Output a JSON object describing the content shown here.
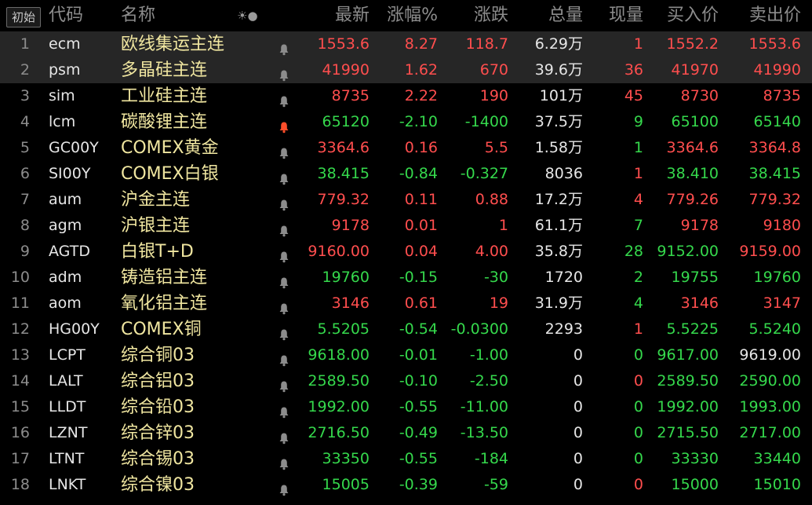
{
  "header": {
    "init_label": "初始",
    "col_code": "代码",
    "col_name": "名称",
    "sort_icon_glyph": "☀●",
    "col_last": "最新",
    "col_pct": "涨幅%",
    "col_change": "涨跌",
    "col_volume": "总量",
    "col_current": "现量",
    "col_bid": "买入价",
    "col_ask": "卖出价"
  },
  "colors": {
    "up": "#ff4e4e",
    "down": "#35d84c",
    "neutral": "#e6e6e6",
    "name": "#f0e6a0",
    "bell_default": "#8c8c8c",
    "bell_active": "#ff4e2a",
    "highlight_row": "#262626"
  },
  "rows": [
    {
      "no": "1",
      "code": "ecm",
      "name": "欧线集运主连",
      "bell": "default",
      "last": "1553.6",
      "pct": "8.27",
      "change": "118.7",
      "volume": "6.29万",
      "current": "1",
      "bid": "1552.2",
      "ask": "1553.6",
      "dir": "up",
      "cur_dir": "up",
      "bid_dir": "up",
      "ask_dir": "up",
      "highlight": true
    },
    {
      "no": "2",
      "code": "psm",
      "name": "多晶硅主连",
      "bell": "default",
      "last": "41990",
      "pct": "1.62",
      "change": "670",
      "volume": "39.6万",
      "current": "36",
      "bid": "41970",
      "ask": "41990",
      "dir": "up",
      "cur_dir": "up",
      "bid_dir": "up",
      "ask_dir": "up",
      "highlight": true
    },
    {
      "no": "3",
      "code": "sim",
      "name": "工业硅主连",
      "bell": "default",
      "last": "8735",
      "pct": "2.22",
      "change": "190",
      "volume": "101万",
      "current": "45",
      "bid": "8730",
      "ask": "8735",
      "dir": "up",
      "cur_dir": "up",
      "bid_dir": "up",
      "ask_dir": "up",
      "highlight": false
    },
    {
      "no": "4",
      "code": "lcm",
      "name": "碳酸锂主连",
      "bell": "active",
      "last": "65120",
      "pct": "-2.10",
      "change": "-1400",
      "volume": "37.5万",
      "current": "9",
      "bid": "65100",
      "ask": "65140",
      "dir": "down",
      "cur_dir": "down",
      "bid_dir": "down",
      "ask_dir": "down",
      "highlight": false
    },
    {
      "no": "5",
      "code": "GC00Y",
      "name": "COMEX黄金",
      "bell": "default",
      "last": "3364.6",
      "pct": "0.16",
      "change": "5.5",
      "volume": "1.58万",
      "current": "1",
      "bid": "3364.6",
      "ask": "3364.8",
      "dir": "up",
      "cur_dir": "down",
      "bid_dir": "up",
      "ask_dir": "up",
      "highlight": false
    },
    {
      "no": "6",
      "code": "SI00Y",
      "name": "COMEX白银",
      "bell": "default",
      "last": "38.415",
      "pct": "-0.84",
      "change": "-0.327",
      "volume": "8036",
      "current": "1",
      "bid": "38.410",
      "ask": "38.415",
      "dir": "down",
      "cur_dir": "up",
      "bid_dir": "down",
      "ask_dir": "down",
      "highlight": false
    },
    {
      "no": "7",
      "code": "aum",
      "name": "沪金主连",
      "bell": "default",
      "last": "779.32",
      "pct": "0.11",
      "change": "0.88",
      "volume": "17.2万",
      "current": "4",
      "bid": "779.26",
      "ask": "779.32",
      "dir": "up",
      "cur_dir": "up",
      "bid_dir": "up",
      "ask_dir": "up",
      "highlight": false
    },
    {
      "no": "8",
      "code": "agm",
      "name": "沪银主连",
      "bell": "default",
      "last": "9178",
      "pct": "0.01",
      "change": "1",
      "volume": "61.1万",
      "current": "7",
      "bid": "9178",
      "ask": "9180",
      "dir": "up",
      "cur_dir": "down",
      "bid_dir": "up",
      "ask_dir": "up",
      "highlight": false
    },
    {
      "no": "9",
      "code": "AGTD",
      "name": "白银T+D",
      "bell": "default",
      "last": "9160.00",
      "pct": "0.04",
      "change": "4.00",
      "volume": "35.8万",
      "current": "28",
      "bid": "9152.00",
      "ask": "9159.00",
      "dir": "up",
      "cur_dir": "down",
      "bid_dir": "down",
      "ask_dir": "up",
      "highlight": false
    },
    {
      "no": "10",
      "code": "adm",
      "name": "铸造铝主连",
      "bell": "default",
      "last": "19760",
      "pct": "-0.15",
      "change": "-30",
      "volume": "1720",
      "current": "2",
      "bid": "19755",
      "ask": "19760",
      "dir": "down",
      "cur_dir": "down",
      "bid_dir": "down",
      "ask_dir": "down",
      "highlight": false
    },
    {
      "no": "11",
      "code": "aom",
      "name": "氧化铝主连",
      "bell": "default",
      "last": "3146",
      "pct": "0.61",
      "change": "19",
      "volume": "31.9万",
      "current": "4",
      "bid": "3146",
      "ask": "3147",
      "dir": "up",
      "cur_dir": "down",
      "bid_dir": "up",
      "ask_dir": "up",
      "highlight": false
    },
    {
      "no": "12",
      "code": "HG00Y",
      "name": "COMEX铜",
      "bell": "default",
      "last": "5.5205",
      "pct": "-0.54",
      "change": "-0.0300",
      "volume": "2293",
      "current": "1",
      "bid": "5.5225",
      "ask": "5.5240",
      "dir": "down",
      "cur_dir": "up",
      "bid_dir": "down",
      "ask_dir": "down",
      "highlight": false
    },
    {
      "no": "13",
      "code": "LCPT",
      "name": "综合铜03",
      "bell": "default",
      "last": "9618.00",
      "pct": "-0.01",
      "change": "-1.00",
      "volume": "0",
      "current": "0",
      "bid": "9617.00",
      "ask": "9619.00",
      "dir": "down",
      "cur_dir": "down",
      "bid_dir": "down",
      "ask_dir": "flat",
      "highlight": false
    },
    {
      "no": "14",
      "code": "LALT",
      "name": "综合铝03",
      "bell": "default",
      "last": "2589.50",
      "pct": "-0.10",
      "change": "-2.50",
      "volume": "0",
      "current": "0",
      "bid": "2589.50",
      "ask": "2590.00",
      "dir": "down",
      "cur_dir": "up",
      "bid_dir": "down",
      "ask_dir": "down",
      "highlight": false
    },
    {
      "no": "15",
      "code": "LLDT",
      "name": "综合铅03",
      "bell": "default",
      "last": "1992.00",
      "pct": "-0.55",
      "change": "-11.00",
      "volume": "0",
      "current": "0",
      "bid": "1992.00",
      "ask": "1993.00",
      "dir": "down",
      "cur_dir": "down",
      "bid_dir": "down",
      "ask_dir": "down",
      "highlight": false
    },
    {
      "no": "16",
      "code": "LZNT",
      "name": "综合锌03",
      "bell": "default",
      "last": "2716.50",
      "pct": "-0.49",
      "change": "-13.50",
      "volume": "0",
      "current": "0",
      "bid": "2715.50",
      "ask": "2717.00",
      "dir": "down",
      "cur_dir": "down",
      "bid_dir": "down",
      "ask_dir": "down",
      "highlight": false
    },
    {
      "no": "17",
      "code": "LTNT",
      "name": "综合锡03",
      "bell": "default",
      "last": "33350",
      "pct": "-0.55",
      "change": "-184",
      "volume": "0",
      "current": "0",
      "bid": "33330",
      "ask": "33440",
      "dir": "down",
      "cur_dir": "down",
      "bid_dir": "down",
      "ask_dir": "down",
      "highlight": false
    },
    {
      "no": "18",
      "code": "LNKT",
      "name": "综合镍03",
      "bell": "default",
      "last": "15005",
      "pct": "-0.39",
      "change": "-59",
      "volume": "0",
      "current": "0",
      "bid": "15000",
      "ask": "15010",
      "dir": "down",
      "cur_dir": "up",
      "bid_dir": "down",
      "ask_dir": "down",
      "highlight": false
    }
  ]
}
